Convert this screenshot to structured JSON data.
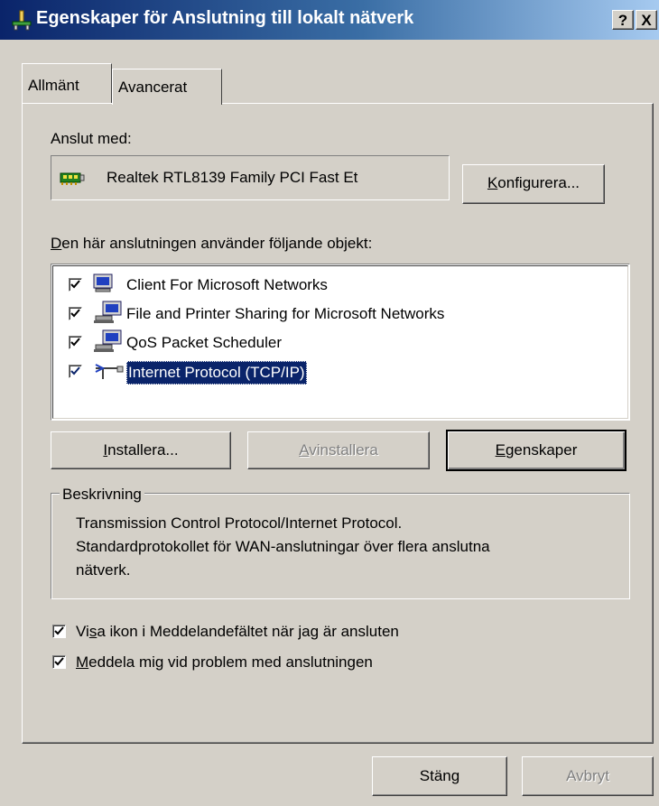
{
  "window": {
    "title": "Egenskaper för Anslutning till lokalt nätverk",
    "help_button": "?",
    "close_button": "X"
  },
  "tabs": [
    {
      "label": "Allmänt",
      "active": true
    },
    {
      "label": "Avancerat",
      "active": false
    }
  ],
  "connect_using": {
    "label": "Anslut med:",
    "adapter": "Realtek RTL8139 Family PCI Fast Et",
    "configure_prefix": "",
    "configure_accel": "K",
    "configure_rest": "onfigurera..."
  },
  "items_section": {
    "label_accel": "D",
    "label_rest": "en här anslutningen använder följande objekt:",
    "items": [
      {
        "label": "Client For Microsoft Networks",
        "checked": true,
        "icon": "network-client-icon"
      },
      {
        "label": "File and Printer Sharing for Microsoft Networks",
        "checked": true,
        "icon": "network-service-icon"
      },
      {
        "label": "QoS Packet Scheduler",
        "checked": true,
        "icon": "network-service-icon"
      },
      {
        "label": "Internet Protocol (TCP/IP)",
        "checked": true,
        "selected": true,
        "icon": "protocol-icon"
      }
    ]
  },
  "actions": {
    "install_accel": "I",
    "install_rest": "nstallera...",
    "uninstall_accel": "A",
    "uninstall_rest": "vinstallera",
    "properties_accel": "E",
    "properties_rest": "genskaper"
  },
  "description": {
    "title": "Beskrivning",
    "lines": [
      "Transmission Control Protocol/Internet Protocol.",
      "Standardprotokollet för WAN-anslutningar över flera anslutna",
      "nätverk."
    ]
  },
  "options": {
    "show_icon_pre": "Vi",
    "show_icon_accel": "s",
    "show_icon_rest": "a ikon i Meddelandefältet när jag är ansluten",
    "show_icon_checked": true,
    "notify_accel": "M",
    "notify_rest": "eddela mig vid problem med anslutningen",
    "notify_checked": true
  },
  "footer": {
    "close_label": "Stäng",
    "cancel_label": "Avbryt"
  },
  "colors": {
    "title_gradient_start": "#0a246a",
    "title_gradient_end": "#a6caf0",
    "face": "#d4d0c8",
    "selection": "#0a246a"
  }
}
